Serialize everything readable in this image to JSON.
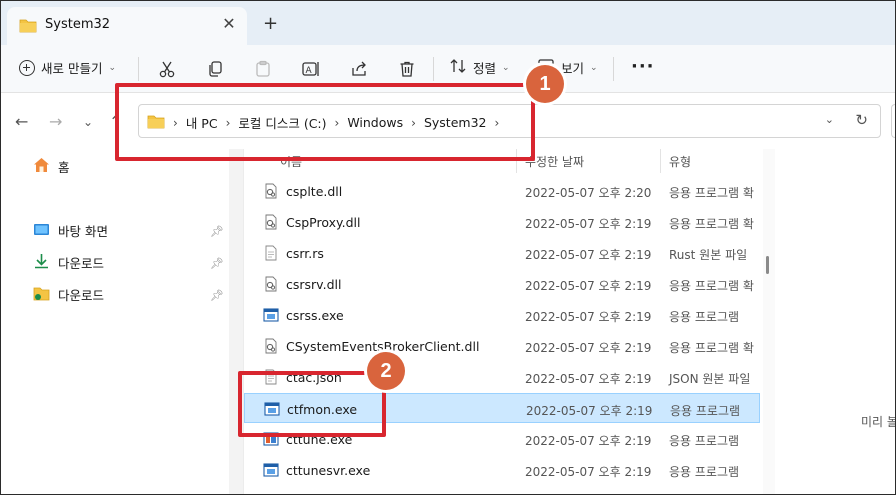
{
  "window": {
    "tab_title": "System32",
    "close_glyph": "✕",
    "new_tab_glyph": "+"
  },
  "toolbar": {
    "new_label": "새로 만들기",
    "sort_label": "정렬",
    "view_label": "보기",
    "more_glyph": "···",
    "icons": [
      "cut-icon",
      "copy-icon",
      "paste-icon",
      "rename-icon",
      "share-icon",
      "delete-icon"
    ]
  },
  "address": {
    "crumbs": [
      "내 PC",
      "로컬 디스크 (C:)",
      "Windows",
      "System32"
    ],
    "refresh_glyph": "↻"
  },
  "sidebar": {
    "home": "홈",
    "items": [
      {
        "label": "바탕 화면",
        "icon": "desktop-icon"
      },
      {
        "label": "다운로드",
        "icon": "download-icon"
      },
      {
        "label": "다운로드",
        "icon": "folder-icon"
      }
    ]
  },
  "columns": {
    "name": "이름",
    "modified": "수정한 날짜",
    "type": "유형"
  },
  "files": [
    {
      "name": "csplte.dll",
      "date": "2022-05-07 오후 2:20",
      "type": "응용 프로그램 확",
      "icon": "dll-icon"
    },
    {
      "name": "CspProxy.dll",
      "date": "2022-05-07 오후 2:19",
      "type": "응용 프로그램 확",
      "icon": "dll-icon"
    },
    {
      "name": "csrr.rs",
      "date": "2022-05-07 오후 2:19",
      "type": "Rust 원본 파일",
      "icon": "file-icon"
    },
    {
      "name": "csrsrv.dll",
      "date": "2022-05-07 오후 2:19",
      "type": "응용 프로그램 확",
      "icon": "dll-icon"
    },
    {
      "name": "csrss.exe",
      "date": "2022-05-07 오후 2:19",
      "type": "응용 프로그램",
      "icon": "exe-icon"
    },
    {
      "name": "CSystemEventsBrokerClient.dll",
      "date": "2022-05-07 오후 2:19",
      "type": "응용 프로그램 확",
      "icon": "dll-icon"
    },
    {
      "name": "ctac.json",
      "date": "2022-05-07 오후 2:19",
      "type": "JSON 원본 파일",
      "icon": "file-icon"
    },
    {
      "name": "ctfmon.exe",
      "date": "2022-05-07 오후 2:19",
      "type": "응용 프로그램",
      "icon": "exe-icon",
      "selected": true
    },
    {
      "name": "cttune.exe",
      "date": "2022-05-07 오후 2:19",
      "type": "응용 프로그램",
      "icon": "tune-icon"
    },
    {
      "name": "cttunesvr.exe",
      "date": "2022-05-07 오후 2:19",
      "type": "응용 프로그램",
      "icon": "exe-icon"
    }
  ],
  "preview": {
    "text": "미리 볼"
  },
  "annotations": {
    "badge1": "1",
    "badge2": "2",
    "color": "#d8262f",
    "badge_color": "#d9643d"
  },
  "colors": {
    "selection": "#cce8ff",
    "folder": "#f4c443",
    "titlebar": "#e6eef6"
  }
}
